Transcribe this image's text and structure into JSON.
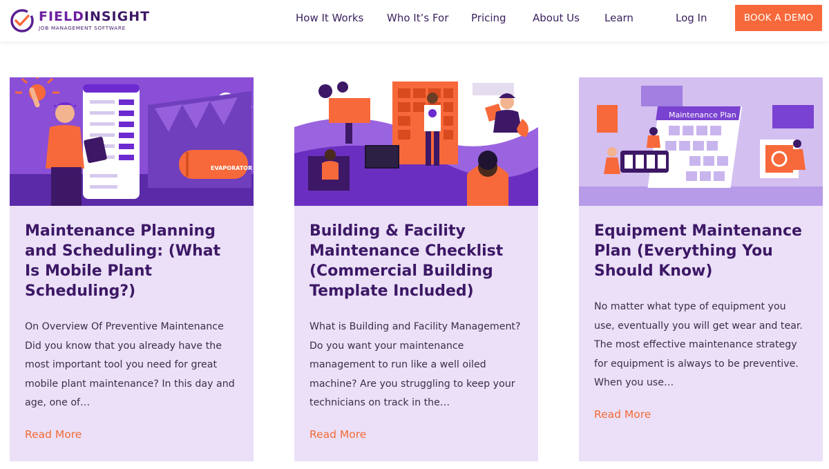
{
  "brand": {
    "name_part1": "FIELD",
    "name_part2": "INSIGHT",
    "tagline": "JOB MANAGEMENT SOFTWARE",
    "colors": {
      "primary": "#3d1866",
      "accent": "#f7693a",
      "card_bg": "#ebe0f7"
    }
  },
  "nav": {
    "items": [
      "How It Works",
      "Who It’s For",
      "Pricing",
      "About Us",
      "Learn"
    ],
    "login": "Log In",
    "cta": "BOOK A DEMO"
  },
  "cards": [
    {
      "title": "Maintenance Planning and Scheduling: (What Is Mobile Plant Scheduling?)",
      "excerpt": "On Overview Of Preventive Maintenance Did you know that you already have the most important tool you need for great mobile plant maintenance? In this day and age, one of…",
      "link": "Read More",
      "image_label": "EVAPORATOR"
    },
    {
      "title": "Building & Facility Maintenance Checklist (Commercial Building Template Included)",
      "excerpt": "What is Building and Facility Management? Do you want your maintenance management to run like a well oiled machine? Are you struggling to keep your technicians on track in the…",
      "link": "Read More"
    },
    {
      "title": "Equipment Maintenance Plan (Everything You Should Know)",
      "excerpt": "No matter what type of equipment you use, eventually you will get wear and tear. The most effective maintenance strategy for equipment is always to be preventive. When you use…",
      "link": "Read More",
      "image_label": "Maintenance Plan"
    }
  ]
}
